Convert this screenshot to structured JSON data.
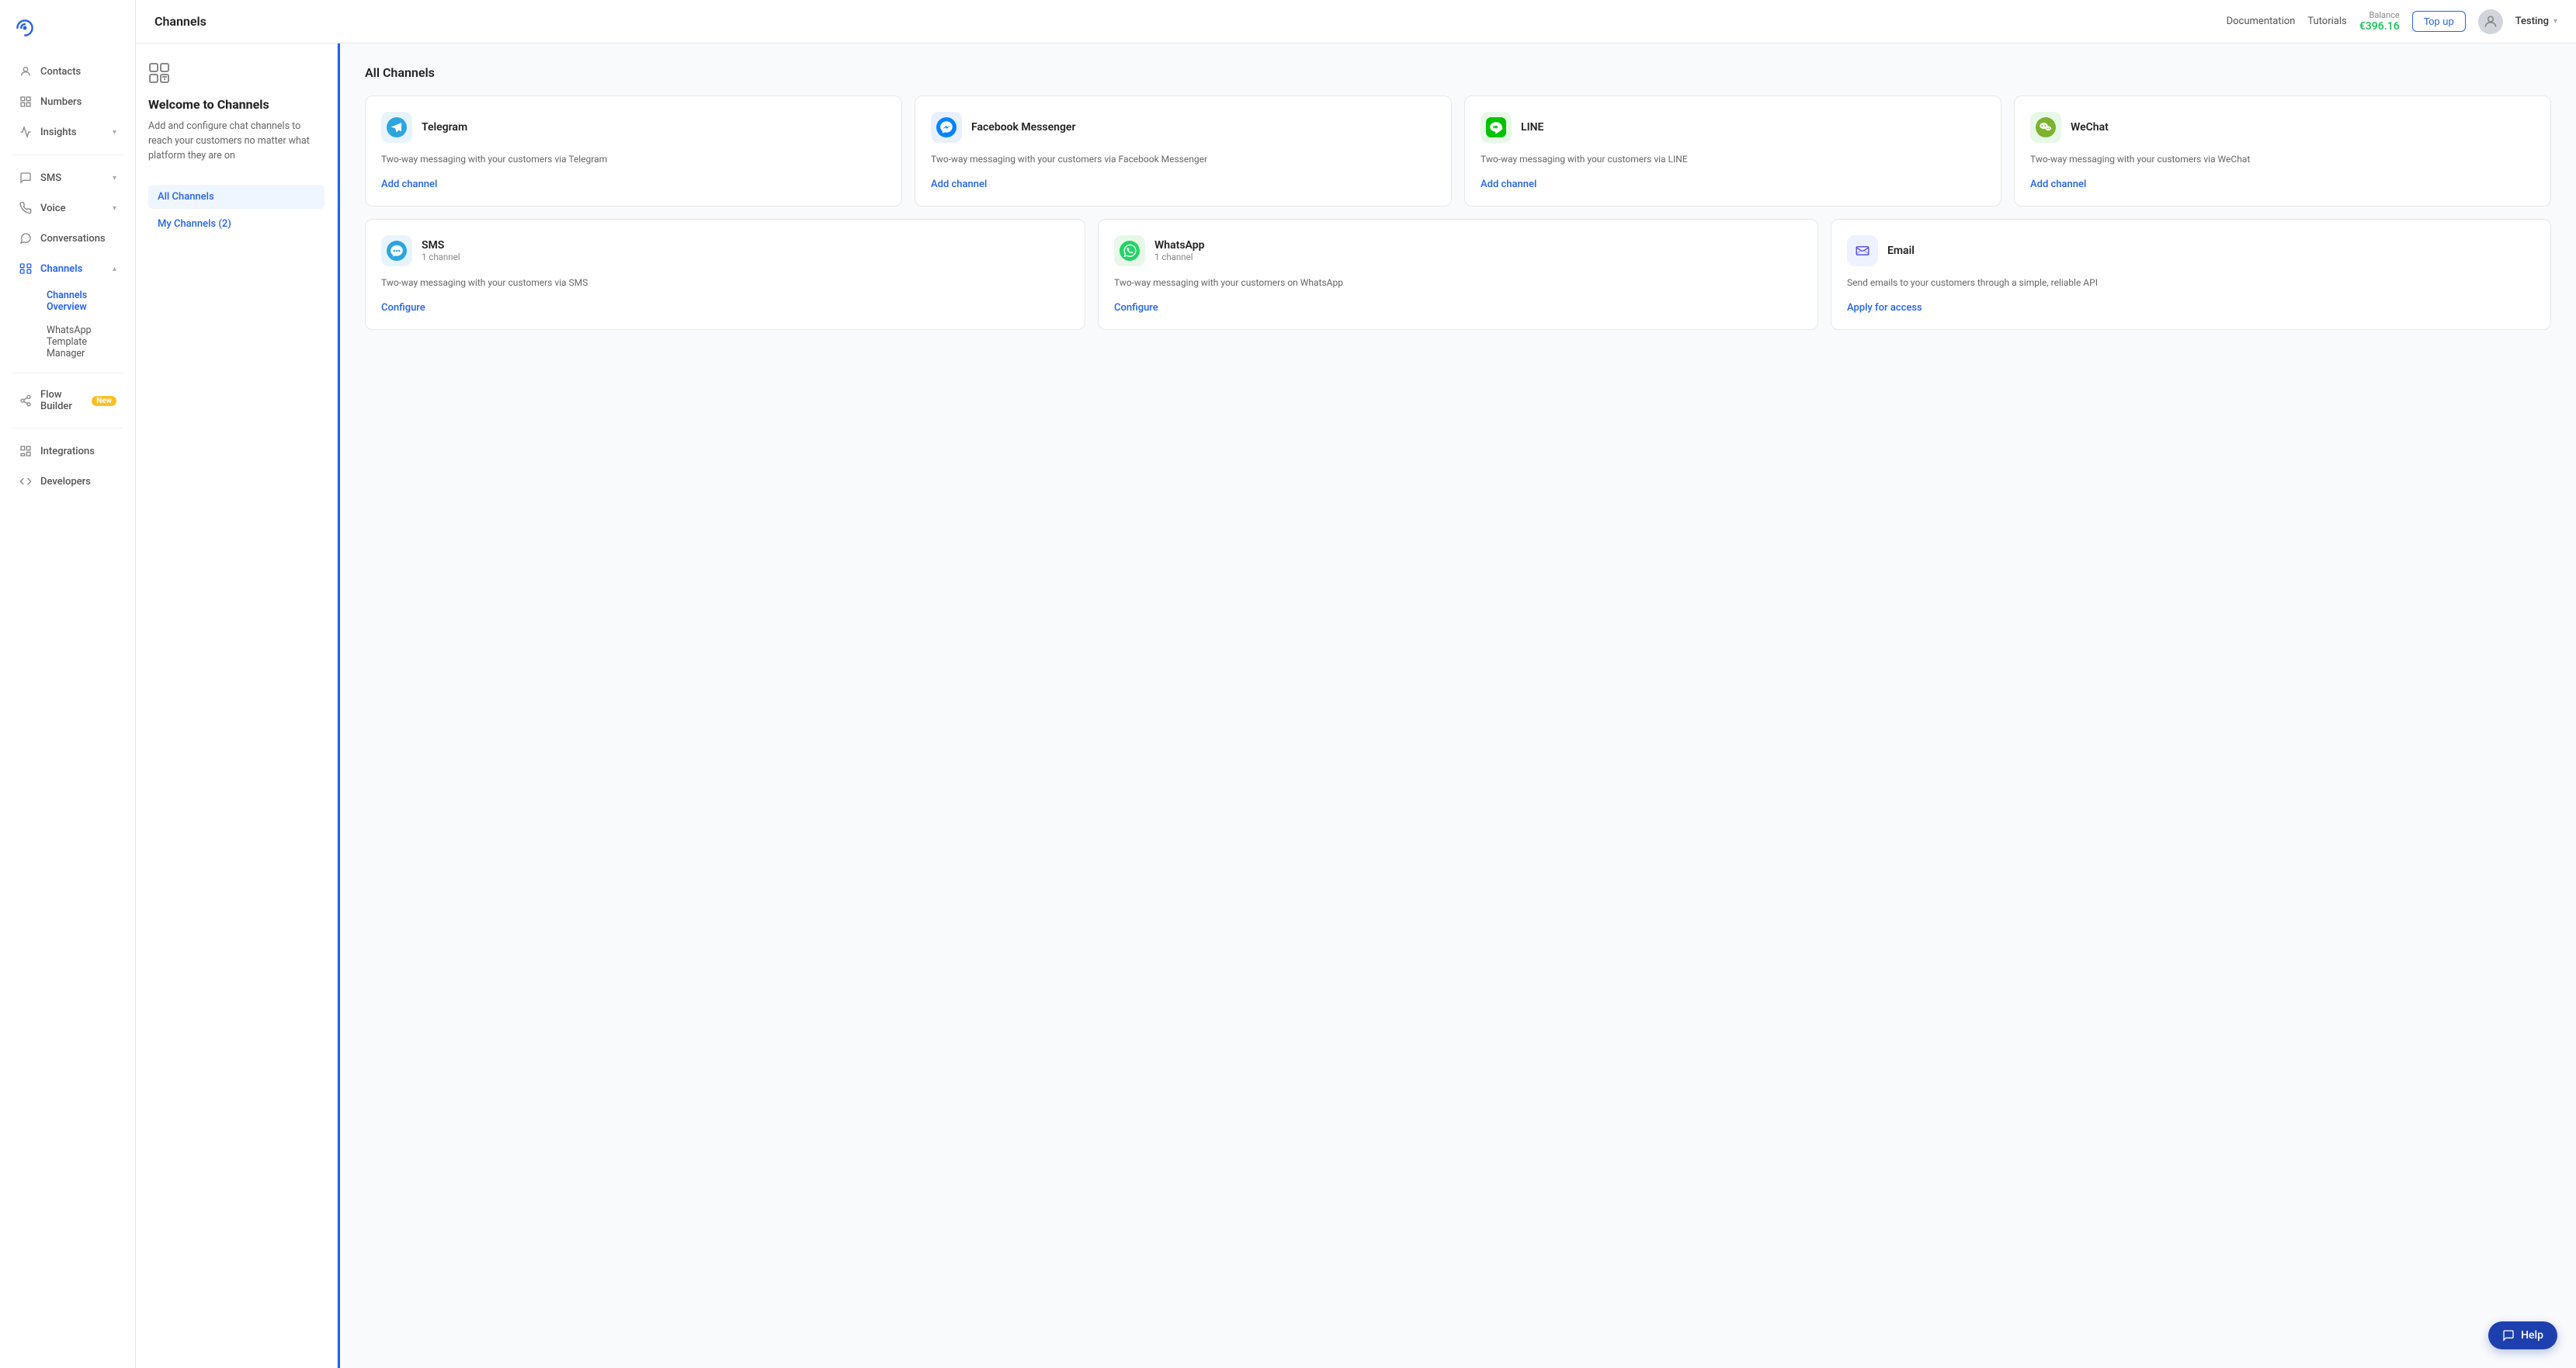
{
  "sidebar": {
    "logo_alt": "Bird logo",
    "nav_items": [
      {
        "id": "contacts",
        "label": "Contacts",
        "icon": "person-icon",
        "active": false,
        "has_chevron": false
      },
      {
        "id": "numbers",
        "label": "Numbers",
        "icon": "grid-icon",
        "active": false,
        "has_chevron": false
      },
      {
        "id": "insights",
        "label": "Insights",
        "icon": "chart-icon",
        "active": false,
        "has_chevron": true
      },
      {
        "id": "sms",
        "label": "SMS",
        "icon": "sms-icon",
        "active": false,
        "has_chevron": true
      },
      {
        "id": "voice",
        "label": "Voice",
        "icon": "voice-icon",
        "active": false,
        "has_chevron": true
      },
      {
        "id": "conversations",
        "label": "Conversations",
        "icon": "chat-icon",
        "active": false,
        "has_chevron": false
      },
      {
        "id": "channels",
        "label": "Channels",
        "icon": "channels-icon",
        "active": true,
        "has_chevron": true
      }
    ],
    "channels_sub": [
      {
        "id": "channels-overview",
        "label": "Channels Overview",
        "active": true
      },
      {
        "id": "whatsapp-template",
        "label": "WhatsApp Template Manager",
        "active": false
      }
    ],
    "bottom_items": [
      {
        "id": "flow-builder",
        "label": "Flow Builder",
        "icon": "flow-icon",
        "badge": "New"
      },
      {
        "id": "integrations",
        "label": "Integrations",
        "icon": "integrations-icon"
      },
      {
        "id": "developers",
        "label": "Developers",
        "icon": "developers-icon"
      }
    ]
  },
  "header": {
    "title": "Channels",
    "docs_label": "Documentation",
    "tutorials_label": "Tutorials",
    "balance_label": "Balance",
    "balance_amount": "€396.16",
    "topup_label": "Top up",
    "user_name": "Testing"
  },
  "left_panel": {
    "icon1": "⊞",
    "icon2": "+",
    "welcome_title": "Welcome to Channels",
    "welcome_desc": "Add and configure chat channels to reach your customers no matter what platform they are on",
    "nav": [
      {
        "id": "all-channels",
        "label": "All Channels",
        "active": true
      },
      {
        "id": "my-channels",
        "label": "My Channels (2)",
        "active": false
      }
    ]
  },
  "channels": {
    "section_title": "All Channels",
    "top_row": [
      {
        "id": "telegram",
        "name": "Telegram",
        "desc": "Two-way messaging with your customers via Telegram",
        "action": "Add channel",
        "icon_char": "✈",
        "icon_class": "icon-telegram"
      },
      {
        "id": "facebook",
        "name": "Facebook Messenger",
        "desc": "Two-way messaging with your customers via Facebook Messenger",
        "action": "Add channel",
        "icon_char": "💬",
        "icon_class": "icon-facebook"
      },
      {
        "id": "line",
        "name": "LINE",
        "desc": "Two-way messaging with your customers via LINE",
        "action": "Add channel",
        "icon_char": "L",
        "icon_class": "icon-line"
      },
      {
        "id": "wechat",
        "name": "WeChat",
        "desc": "Two-way messaging with your customers via WeChat",
        "action": "Add channel",
        "icon_char": "W",
        "icon_class": "icon-wechat"
      }
    ],
    "bottom_row": [
      {
        "id": "sms",
        "name": "SMS",
        "sub": "1 channel",
        "desc": "Two-way messaging with your customers via SMS",
        "action": "Configure",
        "icon_char": "✉",
        "icon_class": "icon-sms"
      },
      {
        "id": "whatsapp",
        "name": "WhatsApp",
        "sub": "1 channel",
        "desc": "Two-way messaging with your customers on WhatsApp",
        "action": "Configure",
        "icon_char": "W",
        "icon_class": "icon-whatsapp"
      },
      {
        "id": "email",
        "name": "Email",
        "sub": "",
        "desc": "Send emails to your customers through a simple, reliable API",
        "action": "Apply for access",
        "icon_char": "✉",
        "icon_class": "icon-email"
      }
    ]
  },
  "help": {
    "label": "Help",
    "icon": "chat-icon"
  }
}
